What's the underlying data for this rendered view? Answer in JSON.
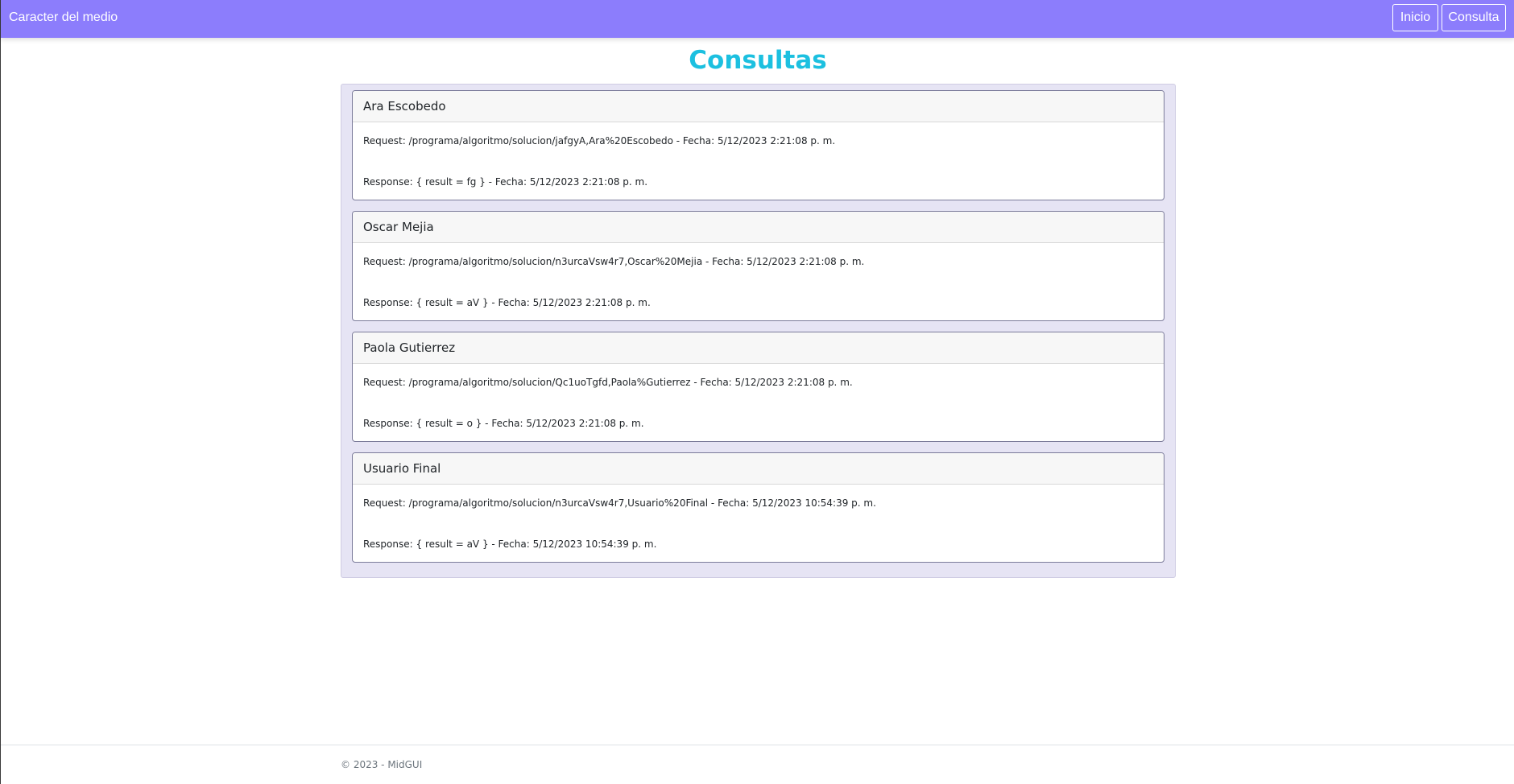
{
  "navbar": {
    "brand": "Caracter del medio",
    "links": [
      {
        "label": "Inicio"
      },
      {
        "label": "Consulta"
      }
    ]
  },
  "page": {
    "title": "Consultas"
  },
  "consultas": [
    {
      "name": "Ara Escobedo",
      "request": "Request: /programa/algoritmo/solucion/jafgyA,Ara%20Escobedo - Fecha: 5/12/2023 2:21:08 p. m.",
      "response": "Response: { result = fg } - Fecha: 5/12/2023 2:21:08 p. m."
    },
    {
      "name": "Oscar Mejia",
      "request": "Request: /programa/algoritmo/solucion/n3urcaVsw4r7,Oscar%20Mejia - Fecha: 5/12/2023 2:21:08 p. m.",
      "response": "Response: { result = aV } - Fecha: 5/12/2023 2:21:08 p. m."
    },
    {
      "name": "Paola Gutierrez",
      "request": "Request: /programa/algoritmo/solucion/Qc1uoTgfd,Paola%Gutierrez - Fecha: 5/12/2023 2:21:08 p. m.",
      "response": "Response: { result = o } - Fecha: 5/12/2023 2:21:08 p. m."
    },
    {
      "name": "Usuario Final",
      "request": "Request: /programa/algoritmo/solucion/n3urcaVsw4r7,Usuario%20Final - Fecha: 5/12/2023 10:54:39 p. m.",
      "response": "Response: { result = aV } - Fecha: 5/12/2023 10:54:39 p. m."
    }
  ],
  "footer": {
    "text": "© 2023 - MidGUI"
  },
  "colors": {
    "navbar": "#8c7dfc",
    "title": "#1cc0e0",
    "panel": "#e6e4f4"
  }
}
